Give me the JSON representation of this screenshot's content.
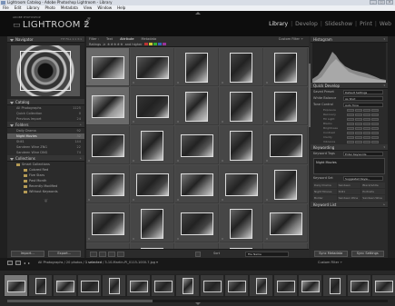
{
  "titlebar": {
    "title": "Lightroom Catalog - Adobe Photoshop Lightroom - Library",
    "buttons": [
      "_",
      "□",
      "X"
    ]
  },
  "menubar": [
    "File",
    "Edit",
    "Library",
    "Photo",
    "Metadata",
    "View",
    "Window",
    "Help"
  ],
  "identity": {
    "small": "ADOBE PHOTOSHOP",
    "brand": "LIGHTROOM 2",
    "beta": "BETA"
  },
  "modules": {
    "items": [
      "Library",
      "Develop",
      "Slideshow",
      "Print",
      "Web"
    ],
    "active": 0,
    "separator": "|"
  },
  "navigator": {
    "title": "Navigator",
    "zoom": "FIT  FILL  1:1  3:1"
  },
  "catalog": {
    "title": "Catalog",
    "items": [
      {
        "label": "All Photographs",
        "count": "1125"
      },
      {
        "label": "Quick Collection",
        "count": "0"
      },
      {
        "label": "Previous Import",
        "count": "24"
      }
    ]
  },
  "folders": {
    "title": "Folders",
    "items": [
      {
        "label": "Daily Drama",
        "count": "92"
      },
      {
        "label": "Night Movies",
        "count": "32",
        "selected": true
      },
      {
        "label": "Still1",
        "count": "144"
      },
      {
        "label": "Sandeen Wine ZNG",
        "count": "22"
      },
      {
        "label": "Sandeen Wine DNG",
        "count": "74"
      }
    ]
  },
  "collections": {
    "title": "Collections",
    "items": [
      {
        "label": "Smart Collections",
        "level": 0
      },
      {
        "label": "Colored Red",
        "level": 1
      },
      {
        "label": "Five Stars",
        "level": 1
      },
      {
        "label": "Past Month",
        "level": 1
      },
      {
        "label": "Recently Modified",
        "level": 1
      },
      {
        "label": "Without Keywords",
        "level": 1
      }
    ]
  },
  "left_buttons": {
    "import": "Import...",
    "export": "Export..."
  },
  "filterbar": {
    "tabs": [
      "Filter :",
      "Text",
      "Attribute",
      "Metadata"
    ],
    "active_tab": 2,
    "custom": "Custom Filter ÷",
    "rating_label": "Ratings",
    "stars": "≥ ★★★★★",
    "and_higher": "and higher",
    "colors": [
      "#b33",
      "#cc3",
      "#3a3",
      "#36b",
      "#939"
    ]
  },
  "grid": {
    "columns": 5,
    "rows": 6,
    "highlight": [
      0,
      5
    ],
    "thumbs": [
      {
        "shape": "land",
        "tone": "#777"
      },
      {
        "shape": "land",
        "tone": "#555"
      },
      {
        "shape": "port",
        "tone": "#666"
      },
      {
        "shape": "port",
        "tone": "#444"
      },
      {
        "shape": "port",
        "tone": "#555"
      },
      {
        "shape": "land",
        "tone": "#999"
      },
      {
        "shape": "land",
        "tone": "#333"
      },
      {
        "shape": "port",
        "tone": "#888"
      },
      {
        "shape": "port",
        "tone": "#555"
      },
      {
        "shape": "port",
        "tone": "#444"
      },
      {
        "shape": "land",
        "tone": "#444"
      },
      {
        "shape": "port",
        "tone": "#666"
      },
      {
        "shape": "land",
        "tone": "#555"
      },
      {
        "shape": "port",
        "tone": "#555"
      },
      {
        "shape": "land",
        "tone": "#333"
      },
      {
        "shape": "land",
        "tone": "#666"
      },
      {
        "shape": "land",
        "tone": "#444"
      },
      {
        "shape": "land",
        "tone": "#777"
      },
      {
        "shape": "land",
        "tone": "#555"
      },
      {
        "shape": "port",
        "tone": "#555"
      },
      {
        "shape": "land",
        "tone": "#555"
      },
      {
        "shape": "port",
        "tone": "#666"
      },
      {
        "shape": "land",
        "tone": "#444"
      },
      {
        "shape": "port",
        "tone": "#666"
      },
      {
        "shape": "land",
        "tone": "#777"
      },
      {
        "shape": "land",
        "tone": "#333"
      },
      {
        "shape": "port",
        "tone": "#555"
      },
      {
        "shape": "land",
        "tone": "#444"
      },
      {
        "shape": "port",
        "tone": "#555"
      },
      {
        "shape": "land",
        "tone": "#666"
      }
    ]
  },
  "toolbar": {
    "sort_label": "Sort",
    "sort_value": "File Name"
  },
  "histogram": {
    "title": "Histogram"
  },
  "quick_develop": {
    "title": "Quick Develop",
    "rows": [
      {
        "label": "Saved Preset",
        "value": "Default Settings"
      },
      {
        "label": "White Balance",
        "value": "As Shot"
      },
      {
        "label": "Tone Control",
        "value": "Auto Tone"
      }
    ],
    "sliders": [
      "Exposure",
      "Recovery",
      "Fill Light",
      "Blacks",
      "Brightness",
      "Contrast",
      "Clarity",
      "Vibrance"
    ]
  },
  "keywording": {
    "title": "Keywording",
    "tags_label": "Keyword Tags",
    "tags_value": "Enter Keywords",
    "keywords": "Night Movies",
    "set_label": "Keyword Set",
    "set_value": "Suggested Keyw...",
    "suggestions": [
      "Daily Drama",
      "Sandeen",
      "Black/white",
      "Night Movies",
      "Still1",
      "Portraits",
      "Bolder",
      "Sandeen Wine",
      "Sandeen Wine"
    ]
  },
  "keyword_list": {
    "title": "Keyword List"
  },
  "right_buttons": {
    "sync_metadata": "Sync Metadata",
    "sync_settings": "Sync Settings"
  },
  "filmstrip_header": {
    "path_prefix": "All Photographs / 20 photos /",
    "selected": "1 selected",
    "filename": "/ 3-10-Martin-PI_0115-1000-7.jpg ▾",
    "filter": "Custom Filter ÷"
  },
  "filmstrip": {
    "count": 16,
    "highlight": 0
  }
}
